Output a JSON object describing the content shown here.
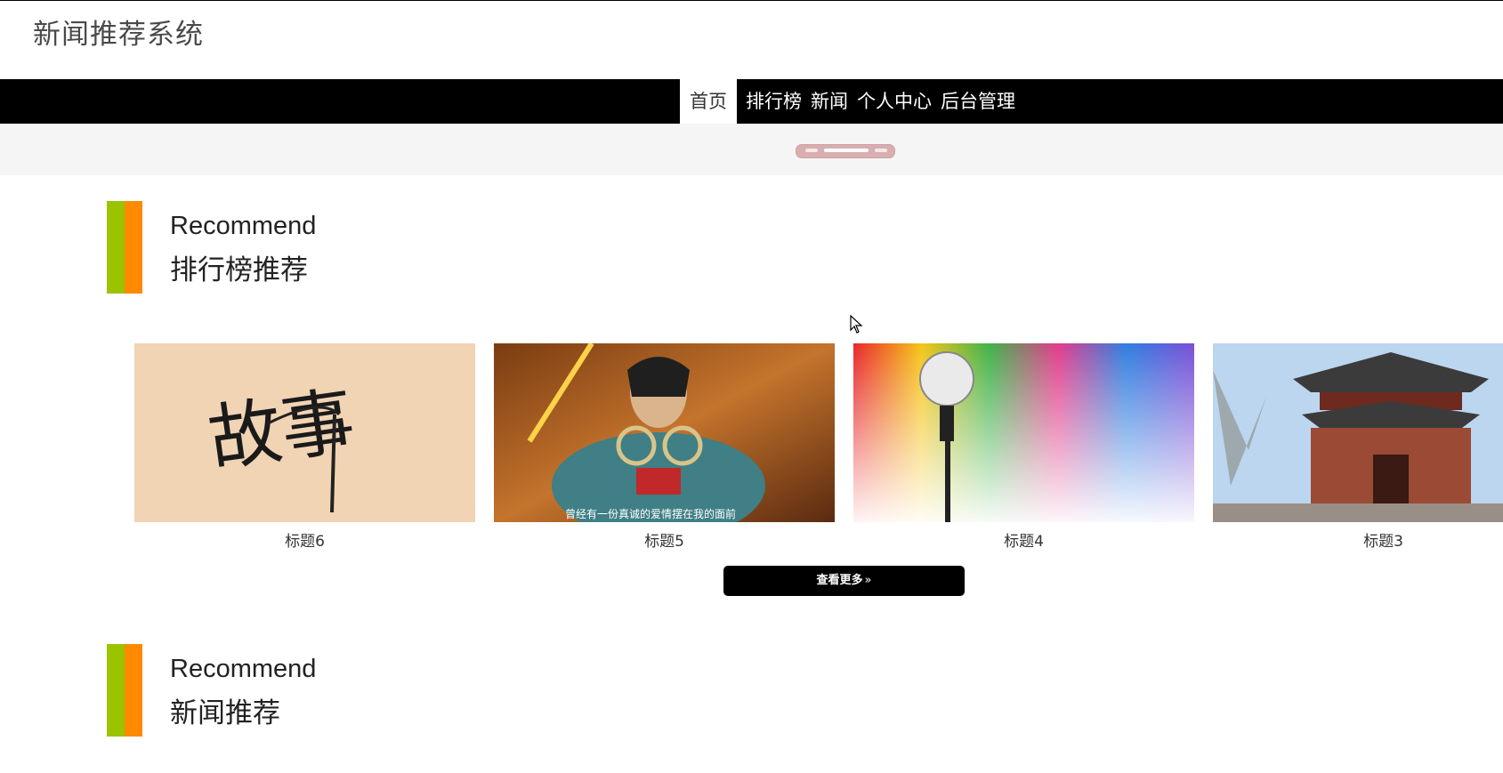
{
  "site_title": "新闻推荐系统",
  "nav": {
    "items": [
      "首页",
      "排行榜",
      "新闻",
      "个人中心",
      "后台管理"
    ]
  },
  "section_rank": {
    "en": "Recommend",
    "cn": "排行榜推荐"
  },
  "cards": [
    {
      "caption": "标题6",
      "image_text": "故事"
    },
    {
      "caption": "标题5",
      "image_subtitle": "曾经有一份真诚的爱情摆在我的面前"
    },
    {
      "caption": "标题4"
    },
    {
      "caption": "标题3"
    }
  ],
  "more_button": {
    "label": "查看更多",
    "icon": "double-chevron-right-icon"
  },
  "section_news": {
    "en": "Recommend",
    "cn": "新闻推荐"
  },
  "colors": {
    "nav_bg": "#000000",
    "accent_green": "#9bc300",
    "accent_orange": "#ff8a00",
    "banner_bg": "#f5f5f5"
  }
}
